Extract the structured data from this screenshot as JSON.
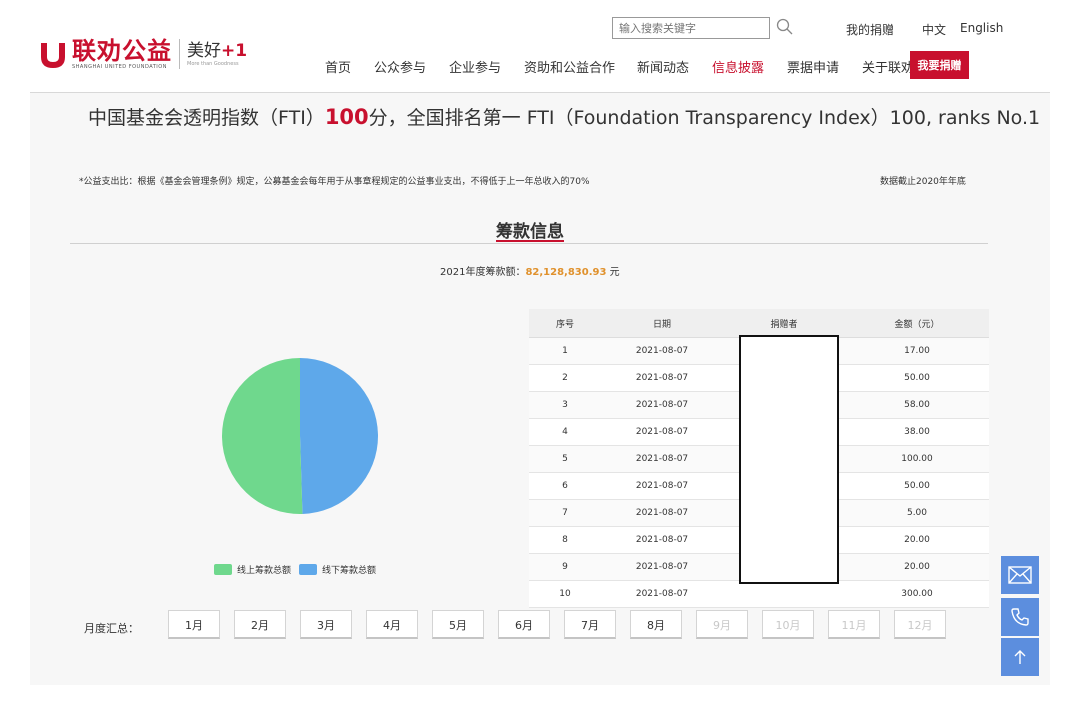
{
  "header": {
    "logo_cn": "联劝公益",
    "logo_en": "SHANGHAI UNITED FOUNDATION",
    "logo_sub": "美好",
    "logo_sub_plus": "+1",
    "logo_sub_en": "More than Goodness",
    "search_placeholder": "输入搜索关键字",
    "my_donations": "我的捐赠",
    "lang_cn": "中文",
    "lang_en": "English",
    "nav": [
      "首页",
      "公众参与",
      "企业参与",
      "资助和公益合作",
      "新闻动态",
      "信息披露",
      "票据申请",
      "关于联劝"
    ],
    "active_nav": "信息披露",
    "donate_button": "我要捐赠",
    "accent_color": "#c8102e"
  },
  "fti": {
    "prefix": "中国基金会透明指数（FTI）",
    "score": "100",
    "suffix": "分，全国排名第一 FTI（Foundation Transparency Index）100, ranks No.1"
  },
  "note": "*公益支出比：根据《基金会管理条例》规定，公募基金会每年用于从事章程规定的公益事业支出，不得低于上一年总收入的70%",
  "as_of": "数据截止2020年年底",
  "section_title": "筹款信息",
  "total": {
    "label": "2021年度筹款额：",
    "amount": "82,128,830.93",
    "unit": "元"
  },
  "chart_data": {
    "type": "pie",
    "labels": [
      "线上筹款总额",
      "线下筹款总额"
    ],
    "values": [
      50.5,
      49.5
    ],
    "colors": [
      "#6fd88d",
      "#5ea8ea"
    ]
  },
  "table": {
    "headers": [
      "序号",
      "日期",
      "捐赠者",
      "金额（元）"
    ],
    "rows": [
      [
        "1",
        "2021-08-07",
        "",
        "17.00"
      ],
      [
        "2",
        "2021-08-07",
        "",
        "50.00"
      ],
      [
        "3",
        "2021-08-07",
        "",
        "58.00"
      ],
      [
        "4",
        "2021-08-07",
        "",
        "38.00"
      ],
      [
        "5",
        "2021-08-07",
        "",
        "100.00"
      ],
      [
        "6",
        "2021-08-07",
        "",
        "50.00"
      ],
      [
        "7",
        "2021-08-07",
        "",
        "5.00"
      ],
      [
        "8",
        "2021-08-07",
        "",
        "20.00"
      ],
      [
        "9",
        "2021-08-07",
        "",
        "20.00"
      ],
      [
        "10",
        "2021-08-07",
        "",
        "300.00"
      ]
    ]
  },
  "monthly": {
    "label": "月度汇总：",
    "months": [
      "1月",
      "2月",
      "3月",
      "4月",
      "5月",
      "6月",
      "7月",
      "8月",
      "9月",
      "10月",
      "11月",
      "12月"
    ],
    "enabled_count": 8
  },
  "side_buttons": [
    "mail-icon",
    "phone-icon",
    "arrow-up-icon"
  ]
}
